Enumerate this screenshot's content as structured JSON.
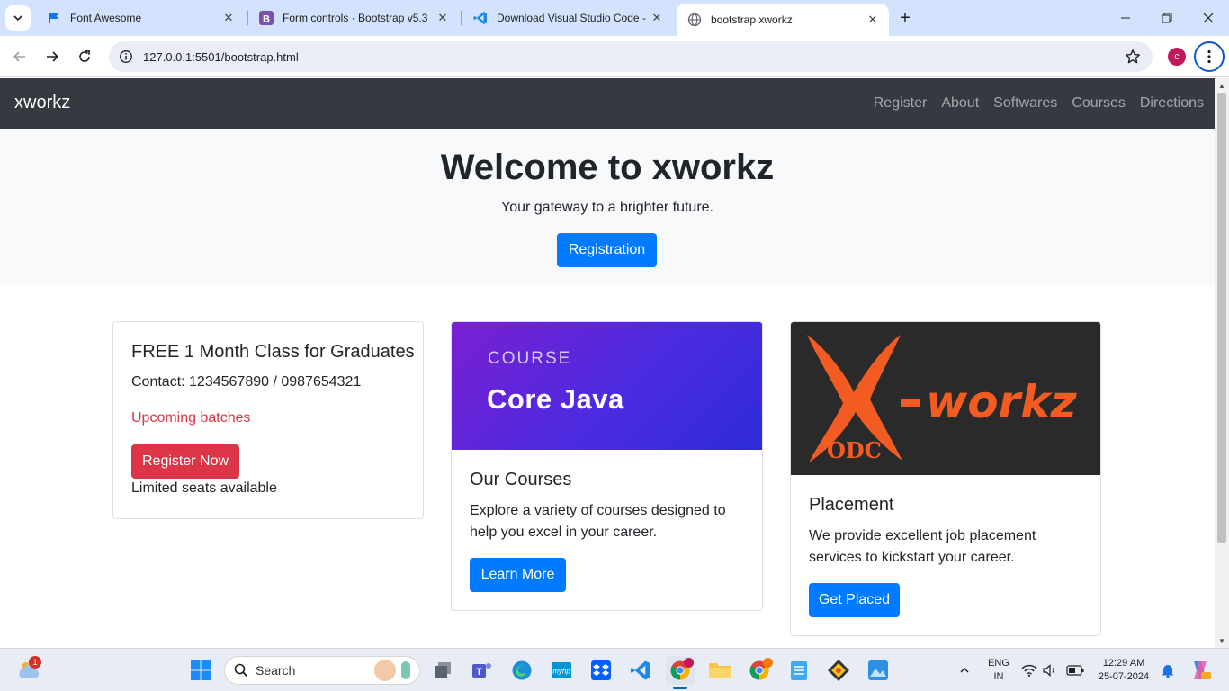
{
  "browser": {
    "tabs": [
      {
        "title": "Font Awesome",
        "active": false
      },
      {
        "title": "Form controls · Bootstrap v5.3",
        "active": false
      },
      {
        "title": "Download Visual Studio Code -",
        "active": false
      },
      {
        "title": "bootstrap xworkz",
        "active": true
      }
    ],
    "url": "127.0.0.1:5501/bootstrap.html",
    "profile_initial": "c"
  },
  "navbar": {
    "brand": "xworkz",
    "links": [
      "Register",
      "About",
      "Softwares",
      "Courses",
      "Directions"
    ]
  },
  "hero": {
    "title": "Welcome to xworkz",
    "subtitle": "Your gateway to a brighter future.",
    "button": "Registration"
  },
  "cards": {
    "offer": {
      "title": "FREE 1 Month Class for Graduates",
      "contact": "Contact: 1234567890 / 0987654321",
      "upcoming": "Upcoming batches",
      "button": "Register Now",
      "note": "Limited seats available"
    },
    "courses": {
      "banner_kicker": "COURSE",
      "banner_title": "Core Java",
      "title": "Our Courses",
      "text": "Explore a variety of courses designed to help you excel in your career.",
      "button": "Learn More"
    },
    "placement": {
      "logo_text": "X-workz",
      "logo_sub": "ODC",
      "title": "Placement",
      "text": "We provide excellent job placement services to kickstart your career.",
      "button": "Get Placed"
    }
  },
  "taskbar": {
    "search_label": "Search",
    "weather_badge": "1",
    "lang_line1": "ENG",
    "lang_line2": "IN",
    "time": "12:29 AM",
    "date": "25-07-2024"
  },
  "colors": {
    "primary": "#007bff",
    "danger": "#dc3545",
    "navbar": "#343a40",
    "hero_bg": "#f8f9fa",
    "tabstrip": "#d3e3fd"
  }
}
